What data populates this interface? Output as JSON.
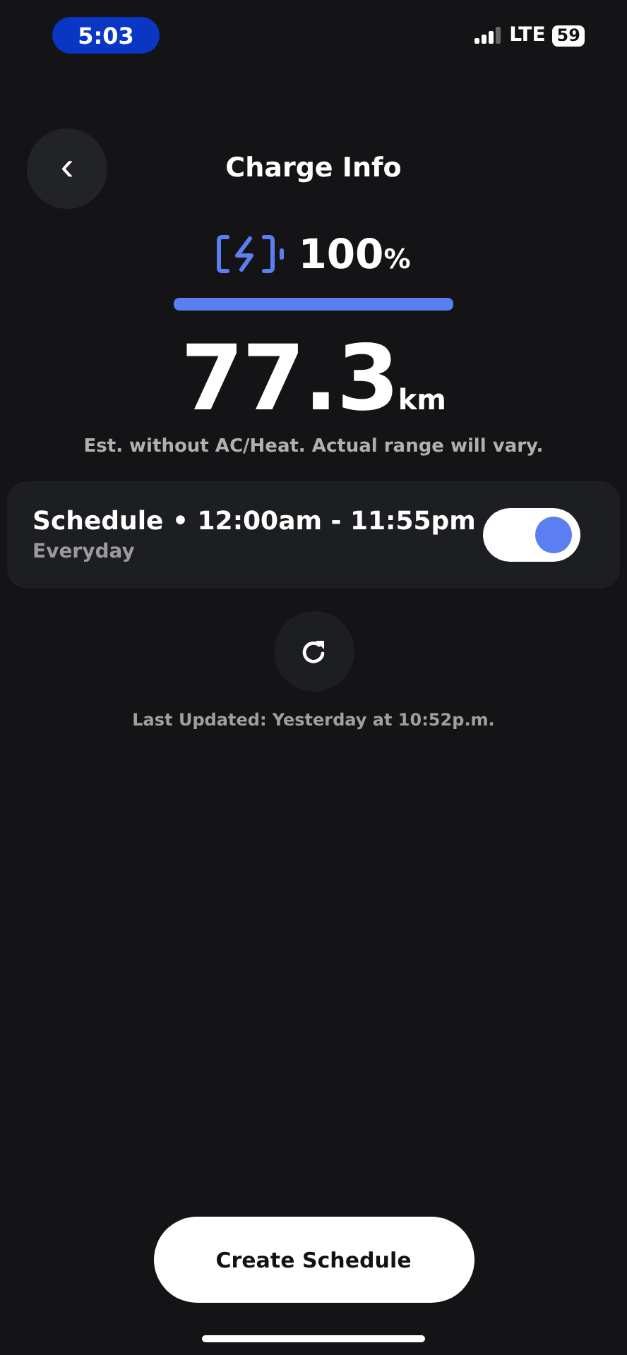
{
  "status_bar": {
    "time": "5:03",
    "network": "LTE",
    "battery": "59"
  },
  "header": {
    "back": "‹",
    "title": "Charge Info"
  },
  "charge": {
    "percent": "100",
    "unit": "%"
  },
  "range": {
    "value": "77.3",
    "unit": "km",
    "note": "Est. without AC/Heat. Actual range will vary."
  },
  "schedule": {
    "title": "Schedule • 12:00am - 11:55pm",
    "days": "Everyday",
    "on": true
  },
  "last_updated": "Last Updated: Yesterday at 10:52p.m.",
  "create_button": "Create Schedule"
}
